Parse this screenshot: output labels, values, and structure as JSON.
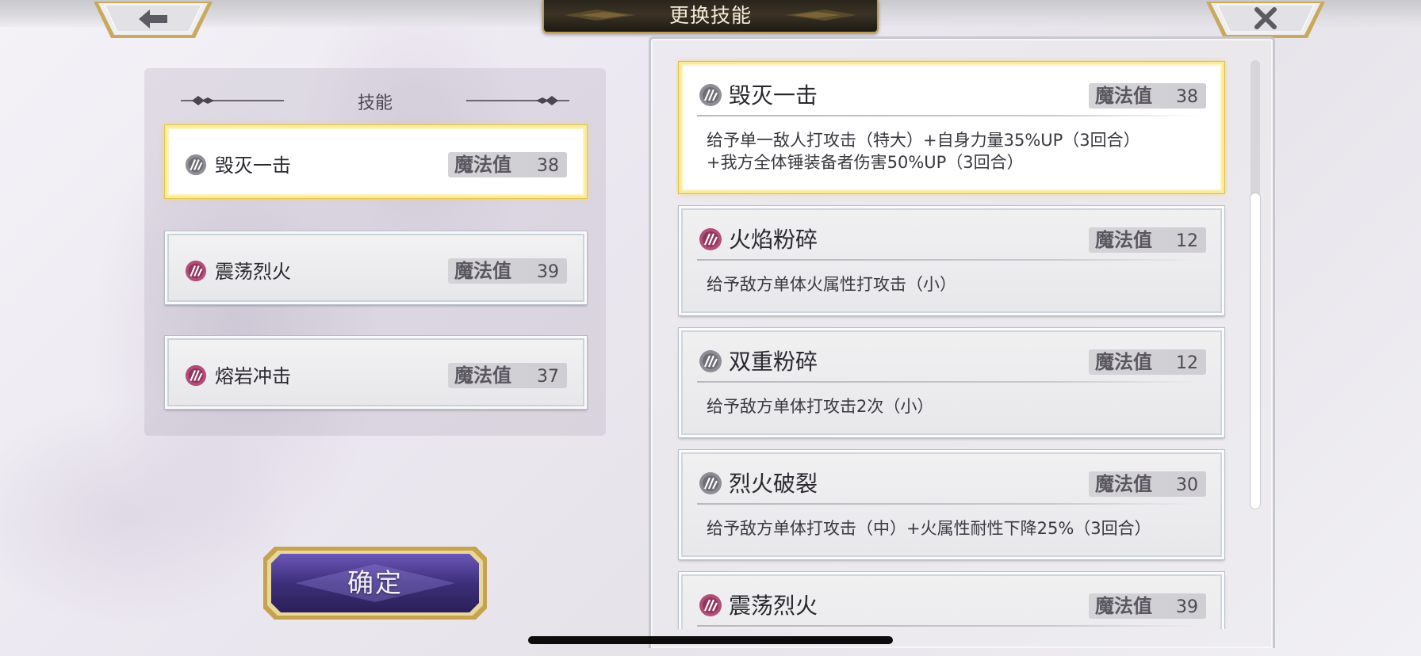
{
  "header": {
    "title": "更换技能",
    "back_icon": "back-arrow-icon",
    "close_icon": "close-icon"
  },
  "equipped_panel": {
    "title": "技能",
    "slots": [
      {
        "name": "毁灭一击",
        "mp_label": "魔法值",
        "mp": "38",
        "icon": "hammer-skill-icon",
        "icon_color": "#8e8c95",
        "selected": true
      },
      {
        "name": "震荡烈火",
        "mp_label": "魔法值",
        "mp": "39",
        "icon": "fire-skill-icon",
        "icon_color": "#b24e78",
        "selected": false
      },
      {
        "name": "熔岩冲击",
        "mp_label": "魔法值",
        "mp": "37",
        "icon": "fire-skill-icon",
        "icon_color": "#b24e78",
        "selected": false
      }
    ]
  },
  "confirm_button": {
    "label": "确定"
  },
  "skill_list": [
    {
      "name": "毁灭一击",
      "mp_label": "魔法值",
      "mp": "38",
      "icon": "hammer-skill-icon",
      "icon_color": "#8e8c95",
      "desc": [
        "给予单一敌人打攻击（特大）+自身力量35%UP（3回合）",
        "+我方全体锤装备者伤害50%UP（3回合）"
      ],
      "selected": true
    },
    {
      "name": "火焰粉碎",
      "mp_label": "魔法值",
      "mp": "12",
      "icon": "fire-skill-icon",
      "icon_color": "#b24e78",
      "desc": [
        "给予敌方单体火属性打攻击（小）"
      ],
      "selected": false
    },
    {
      "name": "双重粉碎",
      "mp_label": "魔法值",
      "mp": "12",
      "icon": "hammer-skill-icon",
      "icon_color": "#8e8c95",
      "desc": [
        "给予敌方单体打攻击2次（小）"
      ],
      "selected": false
    },
    {
      "name": "烈火破裂",
      "mp_label": "魔法值",
      "mp": "30",
      "icon": "hammer-skill-icon",
      "icon_color": "#8e8c95",
      "desc": [
        "给予敌方单体打攻击（中）+火属性耐性下降25%（3回合）"
      ],
      "selected": false
    },
    {
      "name": "震荡烈火",
      "mp_label": "魔法值",
      "mp": "39",
      "icon": "fire-skill-icon",
      "icon_color": "#b24e78",
      "desc": [],
      "selected": false
    }
  ],
  "colors": {
    "selected_border": "#f7ec9c",
    "title_plate": "#2a251c",
    "confirm_button": "#3d2f7a"
  }
}
